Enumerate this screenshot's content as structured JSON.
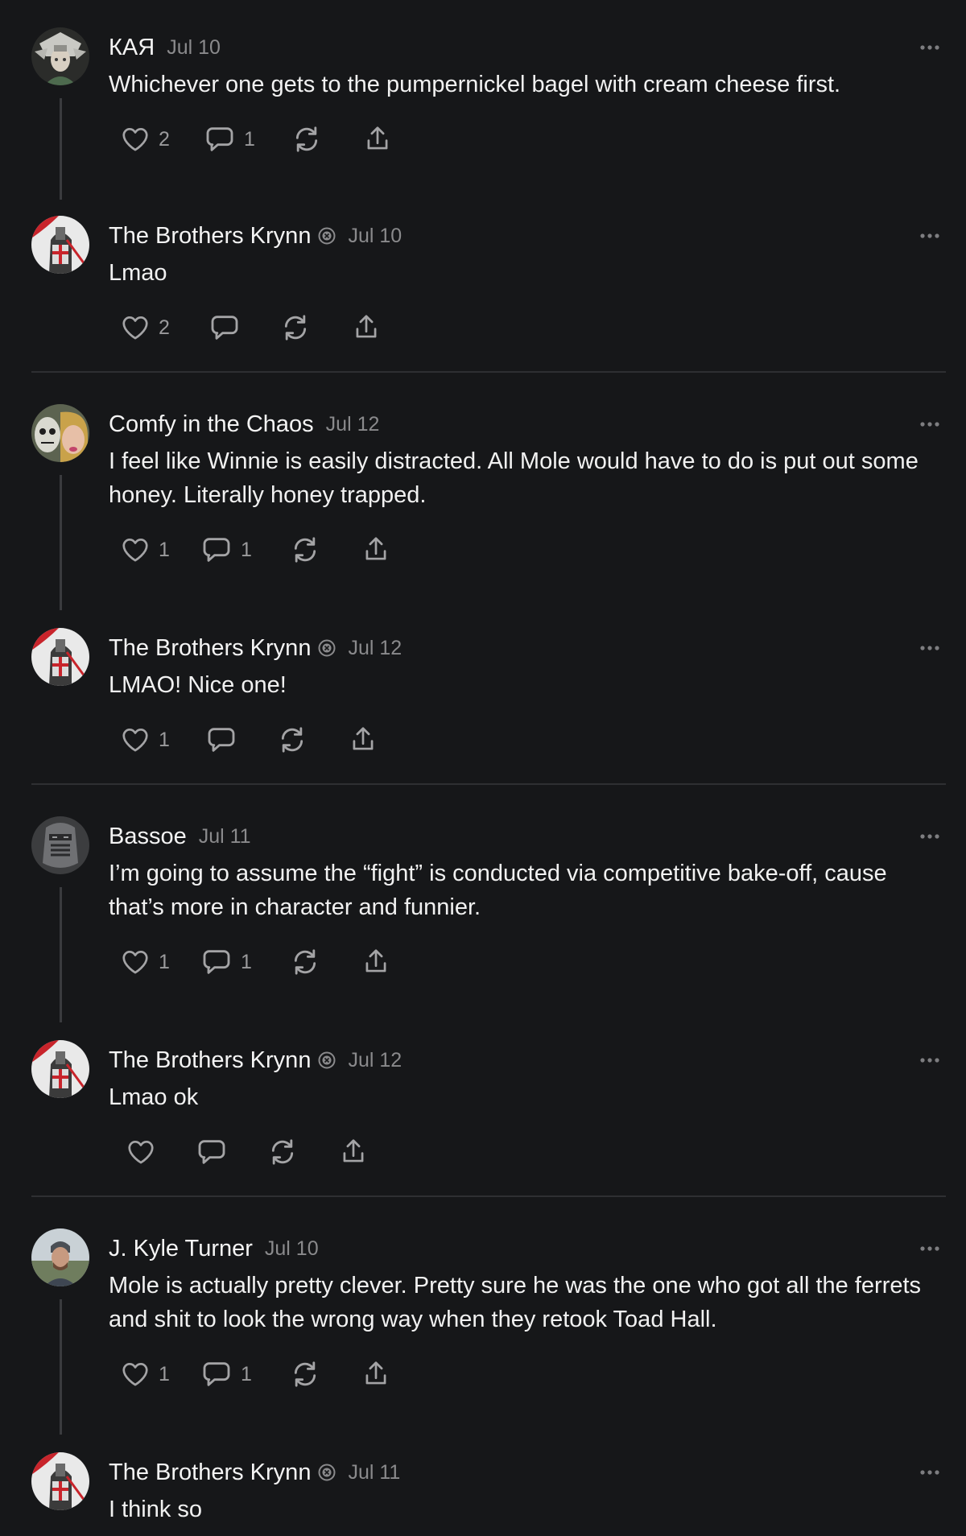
{
  "posts": [
    {
      "author": "КАЯ",
      "date": "Jul 10",
      "verified": false,
      "text": "Whichever one gets to the pumpernickel bagel with cream cheese first.",
      "likes": "2",
      "replies": "1"
    },
    {
      "author": "The Brothers Krynn",
      "date": "Jul 10",
      "verified": true,
      "text": "Lmao",
      "likes": "2",
      "replies": ""
    },
    {
      "author": "Comfy in the Chaos",
      "date": "Jul 12",
      "verified": false,
      "text": "I feel like Winnie is easily distracted. All Mole would have to do is put out some honey. Literally honey trapped.",
      "likes": "1",
      "replies": "1"
    },
    {
      "author": "The Brothers Krynn",
      "date": "Jul 12",
      "verified": true,
      "text": "LMAO! Nice one!",
      "likes": "1",
      "replies": ""
    },
    {
      "author": "Bassoe",
      "date": "Jul 11",
      "verified": false,
      "text": "I’m going to assume the “fight” is conducted via competitive bake-off, cause that’s more in character and funnier.",
      "likes": "1",
      "replies": "1"
    },
    {
      "author": "The Brothers Krynn",
      "date": "Jul 12",
      "verified": true,
      "text": "Lmao ok",
      "likes": "",
      "replies": ""
    },
    {
      "author": "J. Kyle Turner",
      "date": "Jul 10",
      "verified": false,
      "text": "Mole is actually pretty clever. Pretty sure he was the one who got all the ferrets and shit to look the wrong way when they retook Toad Hall.",
      "likes": "1",
      "replies": "1"
    },
    {
      "author": "The Brothers Krynn",
      "date": "Jul 11",
      "verified": true,
      "text": "I think so",
      "likes": "",
      "replies": ""
    }
  ],
  "icons": {
    "like": "heart-icon",
    "reply": "comment-icon",
    "repost": "repost-icon",
    "share": "share-icon",
    "more": "more-icon",
    "badge": "verified-badge-icon"
  },
  "colors": {
    "background": "#161719",
    "text": "#f2f2f2",
    "muted": "#8a8a8c",
    "thread_line": "#3a3b3e",
    "divider": "#2e2f32"
  }
}
